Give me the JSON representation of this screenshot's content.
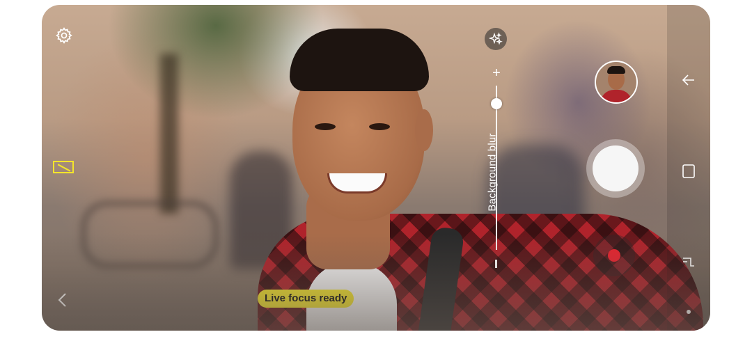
{
  "camera": {
    "mode_status": "Live focus ready",
    "slider_label": "Background blur",
    "slider_plus": "+",
    "slider_value_fraction": 0.1
  },
  "icons": {
    "settings": "gear-icon",
    "aspect_ratio": "aspect-ratio-icon",
    "back": "back-arrow-icon",
    "effects": "sparkle-effects-icon",
    "nav_back": "nav-back-icon",
    "nav_home": "nav-home-icon",
    "nav_recent": "nav-recent-icon"
  },
  "colors": {
    "accent_yellow": "#f4e52a",
    "record_red": "#e8232f"
  }
}
